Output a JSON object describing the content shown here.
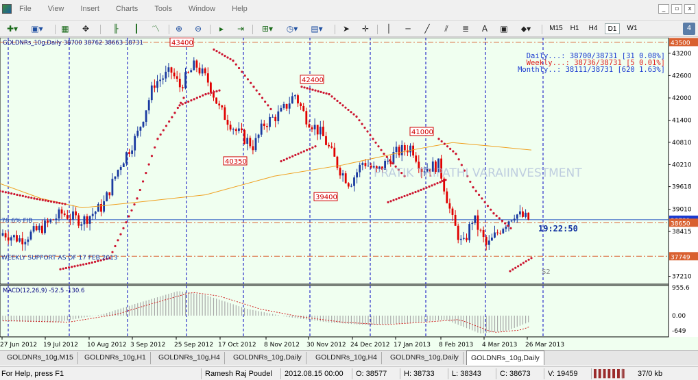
{
  "menu": {
    "items": [
      "File",
      "View",
      "Insert",
      "Charts",
      "Tools",
      "Window",
      "Help"
    ]
  },
  "window_buttons": [
    "_",
    "▫",
    "x"
  ],
  "toolbar": {
    "timeframes": [
      "M15",
      "H1",
      "H4",
      "D1",
      "W1"
    ],
    "active_timeframe": "D1",
    "notification_count": "4"
  },
  "chart": {
    "header": "GOLDNRs_10g,Daily  38700 38762 38663 38731",
    "info_daily": "Daily...: 38700/38731 [31 0.08%]",
    "info_weekly": "Weekly...: 38736/38731 [5 0.01%]",
    "info_monthly": "Monthly..: 38111/38731 [620 1.63%]",
    "watermark": "PRATIK TRIPATHI VARAIINVESTMENT",
    "countdown": "19:22:50",
    "label_fib": "78.6% FIB",
    "label_support": "WEEKLY SUPPORT AS OF 17 FEB 2013",
    "label_s2": "S2",
    "annotations": [
      "43400",
      "42400",
      "41000",
      "40350",
      "39400"
    ],
    "price_axis": [
      "43500",
      "43200",
      "42600",
      "42000",
      "41400",
      "40810",
      "40210",
      "39618",
      "39010",
      "38731",
      "38650",
      "38415",
      "37749",
      "37210"
    ],
    "macd_label": "MACD(12,26,9) -52.5 -130.6",
    "macd_axis": [
      "955.6",
      "0.00",
      "-649"
    ],
    "date_axis": [
      "27 Jun 2012",
      "19 Jul 2012",
      "10 Aug 2012",
      "3 Sep 2012",
      "25 Sep 2012",
      "17 Oct 2012",
      "8 Nov 2012",
      "30 Nov 2012",
      "24 Dec 2012",
      "17 Jan 2013",
      "8 Feb 2013",
      "4 Mar 2013",
      "26 Mar 2013"
    ]
  },
  "tabs": [
    "GOLDNRs_10g,M15",
    "GOLDNRs_10g,H1",
    "GOLDNRs_10g,H4",
    "GOLDNRs_10g,Daily",
    "GOLDNRs_10g,H4",
    "GOLDNRs_10g,Daily",
    "GOLDNRs_10g,Daily"
  ],
  "status": {
    "help": "For Help, press F1",
    "profile": "Ramesh Raj Poudel",
    "datetime": "2012.08.15 00:00",
    "open": "O: 38577",
    "high": "H: 38733",
    "low": "L: 38343",
    "close": "C: 38673",
    "volume": "V: 19459",
    "traffic": "37/0 kb"
  },
  "colors": {
    "chart_bg": "#f0fff0",
    "bull": "#1a3aa0",
    "bear": "#e00000",
    "sar": "#cc1530",
    "ma": "#f0a020",
    "grid": "#0000c0",
    "level": "#d96030"
  }
}
